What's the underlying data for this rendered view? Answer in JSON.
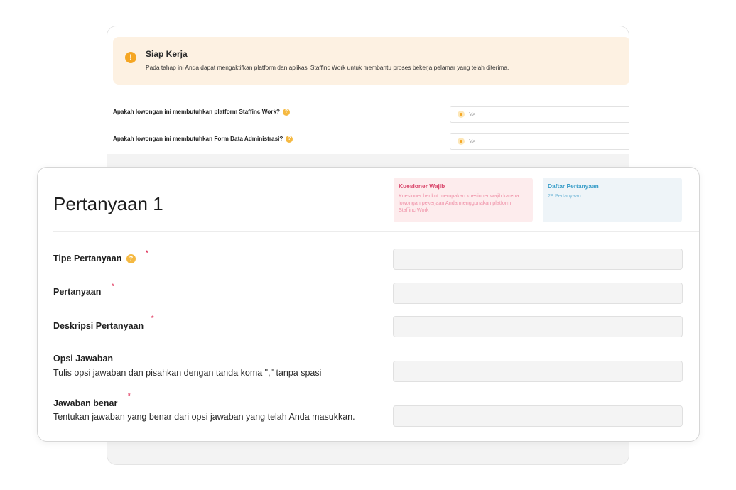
{
  "background_panel": {
    "alert": {
      "icon": "warning-icon",
      "title": "Siap Kerja",
      "text": "Pada tahap ini Anda dapat mengaktifkan platform dan aplikasi Staffinc Work untuk membantu proses bekerja pelamar yang telah diterima."
    },
    "questions": [
      {
        "label": "Apakah lowongan ini membutuhkan platform Staffinc Work?",
        "help_icon": "help-icon",
        "option": "Ya"
      },
      {
        "label": "Apakah lowongan ini membutuhkan Form Data Administrasi?",
        "help_icon": "help-icon",
        "option": "Ya"
      }
    ]
  },
  "question_card": {
    "title": "Pertanyaan 1",
    "mandatory_box": {
      "title": "Kuesioner Wajib",
      "text": "Kuesioner berikut merupakan kuesioner wajib karena lowongan pekerjaan Anda menggunakan platform Staffinc Work",
      "color": "#d9456a"
    },
    "list_box": {
      "title": "Daftar Pertanyaan",
      "text": "28 Pertanyaan",
      "color": "#3a9ec9"
    },
    "fields": {
      "type": {
        "label": "Tipe Pertanyaan",
        "required": "*",
        "help": "?"
      },
      "question": {
        "label": "Pertanyaan",
        "required": "*"
      },
      "description": {
        "label": "Deskripsi Pertanyaan",
        "required": "*"
      },
      "options": {
        "label": "Opsi Jawaban",
        "hint": "Tulis opsi jawaban dan pisahkan dengan tanda koma \",\" tanpa spasi"
      },
      "answer": {
        "label": "Jawaban benar",
        "required": "*",
        "hint": "Tentukan jawaban yang benar dari opsi jawaban yang telah Anda masukkan."
      }
    }
  },
  "colors": {
    "accent_orange": "#f5a623",
    "alert_bg": "#fdf1e2",
    "required": "#e0335a"
  }
}
